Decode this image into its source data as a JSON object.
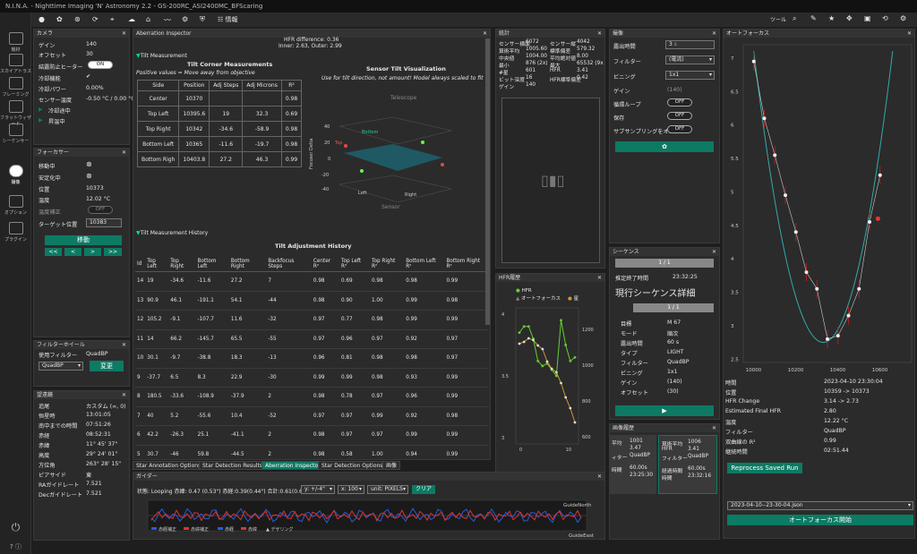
{
  "window": {
    "title": "N.I.N.A. - Nighttime Imaging 'N' Astronomy 2.2  -  GS-200RC_ASI2400MC_BFScaring"
  },
  "toolbar": {
    "info_label": "情報",
    "tools_label": "ツール"
  },
  "nav": [
    {
      "label": "機材"
    },
    {
      "label": "スカイアトラス"
    },
    {
      "label": "フレーミング"
    },
    {
      "label": "フラットウィザード"
    },
    {
      "label": "シーケンサー"
    },
    {
      "label": "撮像"
    },
    {
      "label": "オプション"
    },
    {
      "label": "プラグイン"
    }
  ],
  "camera": {
    "title": "カメラ",
    "rows": [
      {
        "k": "ゲイン",
        "v": "140"
      },
      {
        "k": "オフセット",
        "v": "30"
      },
      {
        "k": "結露防止ヒーター",
        "v": "ON"
      },
      {
        "k": "冷却機能",
        "v": ""
      },
      {
        "k": "冷却パワー",
        "v": "0.00%"
      },
      {
        "k": "センサー温度",
        "v": "-0.50 °C / 0.00 °C"
      }
    ],
    "cool_label": "冷却途中",
    "warm_label": "昇温中"
  },
  "focuser": {
    "title": "フォーカサー",
    "rows": [
      {
        "k": "移動中",
        "v": ""
      },
      {
        "k": "安定化中",
        "v": ""
      },
      {
        "k": "位置",
        "v": "10373"
      },
      {
        "k": "温度",
        "v": "12.02 °C"
      },
      {
        "k": "温度補正",
        "v": "OFF"
      },
      {
        "k": "ターゲット位置",
        "v": "10383"
      }
    ],
    "move_label": "移動",
    "btns": [
      "<<",
      "<",
      ">",
      ">>"
    ]
  },
  "filterwheel": {
    "title": "フィルターホイール",
    "using_label": "使用フィルター",
    "using_value": "QuadBP",
    "select_value": "QuadBP",
    "change_label": "変更"
  },
  "tracking": {
    "title": "望遠鏡",
    "rows": [
      {
        "k": "追尾",
        "v": "カスタム (∞, 0)"
      },
      {
        "k": "恒星時",
        "v": "13:01:05"
      },
      {
        "k": "南中までの時間",
        "v": "07:51:26"
      },
      {
        "k": "赤経",
        "v": "08:52:31"
      },
      {
        "k": "赤緯",
        "v": "11° 45' 37\""
      },
      {
        "k": "高度",
        "v": "29° 24' 01\""
      },
      {
        "k": "方位角",
        "v": "263° 28' 15\""
      },
      {
        "k": "ピアサイド",
        "v": "東"
      },
      {
        "k": "RAガイドレート",
        "v": "7.521"
      },
      {
        "k": "Decガイドレート",
        "v": "7.521"
      }
    ]
  },
  "aberration": {
    "title": "Aberration Inspector",
    "hfr_diff": "HFR difference: 0.36",
    "inner_outer": "Inner: 2.63, Outer: 2.99",
    "tilt_section": "Tilt Measurement",
    "corner_title": "Tilt Corner Measurements",
    "corner_note": "Positive values = Move away from objective",
    "corner_headers": [
      "Side",
      "Position",
      "Adj Steps",
      "Adj Microns",
      "R²"
    ],
    "corner_rows": [
      [
        "Center",
        "10370",
        "",
        "",
        "0.98"
      ],
      [
        "Top Left",
        "10395.6",
        "19",
        "32.3",
        "0.69"
      ],
      [
        "Top Right",
        "10342",
        "-34.6",
        "-58.9",
        "0.98"
      ],
      [
        "Bottom Left",
        "10365",
        "-11.6",
        "-19.7",
        "0.98"
      ],
      [
        "Bottom Righ",
        "10403.8",
        "27.2",
        "46.3",
        "0.99"
      ]
    ],
    "viz_title": "Sensor Tilt Visualization",
    "viz_note": "Use for tilt direction, not amount! Model always scaled to fit",
    "viz_telescope": "Telescope",
    "viz_sensor": "Sensor",
    "viz_top": "Top",
    "viz_bottom": "Bottom",
    "viz_left": "Left",
    "viz_right": "Right",
    "viz_zlabel": "Focuser Delta",
    "viz_ticks": [
      "40",
      "20",
      "0",
      "-20",
      "-40"
    ],
    "history_section": "Tilt Measurement History",
    "history_title": "Tilt Adjustment History",
    "history_headers": [
      "Id",
      "Top Left",
      "Top Right",
      "Bottom Left",
      "Bottom Right",
      "Backfocus Steps",
      "Center R²",
      "Top Left R²",
      "Top Right R²",
      "Bottom Left R²",
      "Bottom Right R²"
    ],
    "history_rows": [
      [
        "14",
        "19",
        "-34.6",
        "-11.6",
        "27.2",
        "7",
        "0.98",
        "0.69",
        "0.98",
        "0.98",
        "0.99"
      ],
      [
        "13",
        "90.9",
        "46.1",
        "-191.1",
        "54.1",
        "-44",
        "0.98",
        "0.90",
        "1.00",
        "0.99",
        "0.98"
      ],
      [
        "12",
        "105.2",
        "-9.1",
        "-107.7",
        "11.6",
        "-32",
        "0.97",
        "0.77",
        "0.98",
        "0.99",
        "0.99"
      ],
      [
        "11",
        "14",
        "66.2",
        "-145.7",
        "65.5",
        "-55",
        "0.97",
        "0.96",
        "0.97",
        "0.92",
        "0.97"
      ],
      [
        "10",
        "30.1",
        "-9.7",
        "-38.8",
        "18.3",
        "-13",
        "0.96",
        "0.81",
        "0.98",
        "0.98",
        "0.97"
      ],
      [
        "9",
        "-37.7",
        "6.5",
        "8.3",
        "22.9",
        "-30",
        "0.99",
        "0.99",
        "0.98",
        "0.93",
        "0.99"
      ],
      [
        "8",
        "180.5",
        "-33.6",
        "-108.9",
        "-37.9",
        "2",
        "0.98",
        "0.78",
        "0.97",
        "0.96",
        "0.99"
      ],
      [
        "7",
        "40",
        "5.2",
        "-55.6",
        "10.4",
        "-52",
        "0.97",
        "0.97",
        "0.99",
        "0.92",
        "0.98"
      ],
      [
        "6",
        "42.2",
        "-26.3",
        "25.1",
        "-41.1",
        "2",
        "0.98",
        "0.97",
        "0.97",
        "0.99",
        "0.99"
      ],
      [
        "5",
        "30.7",
        "-46",
        "59.8",
        "-44.5",
        "2",
        "0.98",
        "0.58",
        "1.00",
        "0.94",
        "0.99"
      ],
      [
        "4",
        "-39.8",
        "186.9",
        "-78.7",
        "-68.3",
        "55",
        "0.97",
        "0.96",
        "-0.01",
        "0.35",
        "0.96"
      ]
    ]
  },
  "tabs": [
    "Star Annotation Options",
    "Star Detection Results",
    "Aberration Inspector",
    "Star Detection Options",
    "画像"
  ],
  "stats": {
    "title": "統計",
    "rows": [
      {
        "k": "センサー横面",
        "v": "6072"
      },
      {
        "k": "センサー縦",
        "v": "4042"
      },
      {
        "k": "算術平均",
        "v": "1005.60"
      },
      {
        "k": "標準偏差",
        "v": "579.32"
      },
      {
        "k": "中央値",
        "v": "1004.00"
      },
      {
        "k": "平均絶対値",
        "v": "8.00"
      },
      {
        "k": "最小",
        "v": "876 (2x)"
      },
      {
        "k": "最大",
        "v": "65532 (9x"
      },
      {
        "k": "#星",
        "v": "601"
      },
      {
        "k": "HFR",
        "v": "3.41"
      },
      {
        "k": "ビット深度",
        "v": "16"
      },
      {
        "k": "HFR標準偏差",
        "v": "0.42"
      },
      {
        "k": "ゲイン",
        "v": "140"
      }
    ]
  },
  "hfr_history": {
    "title": "HFR履歴",
    "legend_hfr": "HFR",
    "legend_af": "オートフォーカス",
    "legend_stars": "星",
    "y_left": [
      "4",
      "3.5",
      "3"
    ],
    "y_right": [
      "1200",
      "1000",
      "800",
      "600"
    ],
    "x": [
      "0",
      "10"
    ],
    "chart_data": {
      "type": "line",
      "series": [
        {
          "name": "HFR",
          "values": [
            3.85,
            3.9,
            3.9,
            3.8,
            3.62,
            3.58,
            3.6,
            3.55,
            3.5,
            3.95,
            3.75,
            3.62,
            3.65
          ]
        },
        {
          "name": "星",
          "values": [
            1120,
            1130,
            1150,
            1140,
            1110,
            1090,
            1020,
            980,
            960,
            900,
            820,
            760,
            680
          ]
        }
      ]
    }
  },
  "imaging": {
    "title": "撮像",
    "rows": [
      {
        "k": "露出時間",
        "v": "3"
      },
      {
        "k": "フィルター",
        "v": "(電流)"
      },
      {
        "k": "ビニング",
        "v": "1x1"
      },
      {
        "k": "ゲイン",
        "v": "(140)"
      },
      {
        "k": "循環ループ",
        "v": "OFF"
      },
      {
        "k": "保存",
        "v": "OFF"
      },
      {
        "k": "サブサンプリングをオンに",
        "v": "OFF"
      }
    ],
    "exp_unit": "s"
  },
  "sequence": {
    "title": "シーケンス",
    "progress": "1 / 1",
    "end_label": "推定終了時間",
    "end_value": "23:32:25",
    "detail_title": "現行シーケンス詳細",
    "progress2": "1 / 1",
    "rows": [
      {
        "k": "目標",
        "v": "M 67"
      },
      {
        "k": "モード",
        "v": "順次"
      },
      {
        "k": "露出時間",
        "v": "60 s"
      },
      {
        "k": "タイプ",
        "v": "LIGHT"
      },
      {
        "k": "フィルター",
        "v": "QuadBP"
      },
      {
        "k": "ビニング",
        "v": "1x1"
      },
      {
        "k": "ゲイン",
        "v": "(140)"
      },
      {
        "k": "オフセット",
        "v": "(30)"
      }
    ]
  },
  "image_history": {
    "title": "画像履歴",
    "a": [
      {
        "k": "平均",
        "v": "1001"
      },
      {
        "k": "",
        "v": "3.47"
      },
      {
        "k": "ィター",
        "v": "QuadBP"
      },
      {
        "k": "時間",
        "v": "60.00s"
      },
      {
        "k": "",
        "v": "23:25:30"
      }
    ],
    "b": [
      {
        "k": "算術平均",
        "v": "1006"
      },
      {
        "k": "HFR",
        "v": "3.41"
      },
      {
        "k": "フィルター",
        "v": "QuadBP"
      },
      {
        "k": "経過時間",
        "v": "60.00s"
      },
      {
        "k": "時間",
        "v": "23:32:16"
      }
    ]
  },
  "autofocus": {
    "title": "オートフォーカス",
    "y_ticks": [
      "7",
      "6.5",
      "6",
      "5.5",
      "5",
      "4.5",
      "4",
      "3.5",
      "3",
      "2.5"
    ],
    "x_ticks": [
      "10000",
      "10200",
      "10400",
      "10600"
    ],
    "chart_data": {
      "type": "scatter",
      "x": [
        10000,
        10050,
        10100,
        10150,
        10200,
        10250,
        10300,
        10350,
        10400,
        10450,
        10500,
        10550,
        10600
      ],
      "values": [
        6.95,
        6.1,
        5.55,
        4.95,
        4.4,
        3.8,
        3.55,
        2.8,
        2.85,
        3.15,
        3.55,
        4.55,
        5.25
      ]
    },
    "info": [
      {
        "k": "時間",
        "v": "2023-04-10 23:30:04"
      },
      {
        "k": "位置",
        "v": "10359 -> 10373"
      },
      {
        "k": "HFR Change",
        "v": "3.14 -> 2.73"
      },
      {
        "k": "Estimated Final HFR",
        "v": "2.80"
      },
      {
        "k": "温度",
        "v": "12.22 °C"
      },
      {
        "k": "フィルター",
        "v": "QuadBP"
      },
      {
        "k": "双曲線の R²",
        "v": "0.99"
      },
      {
        "k": "継続時間",
        "v": "02:51.44"
      }
    ],
    "reprocess_label": "Reprocess Saved Run",
    "file_value": "2023-04-10--23-30-04.json",
    "start_label": "オートフォーカス開始"
  },
  "guider": {
    "title": "ガイダー",
    "status": "状態: Looping 赤緯: 0.47 (0.53\") 赤経:0.39(0.44\") 合計:0.61(0.69\")",
    "y_select": "y: +/-4\"",
    "x_select": "x: 100",
    "unit_select": "unit: PIXELS",
    "clear_label": "クリア",
    "north": "GuideNorth",
    "east": "GuideEast",
    "legend": [
      "赤経補正",
      "赤緯補正",
      "赤経",
      "赤緯",
      "デザリング"
    ]
  }
}
